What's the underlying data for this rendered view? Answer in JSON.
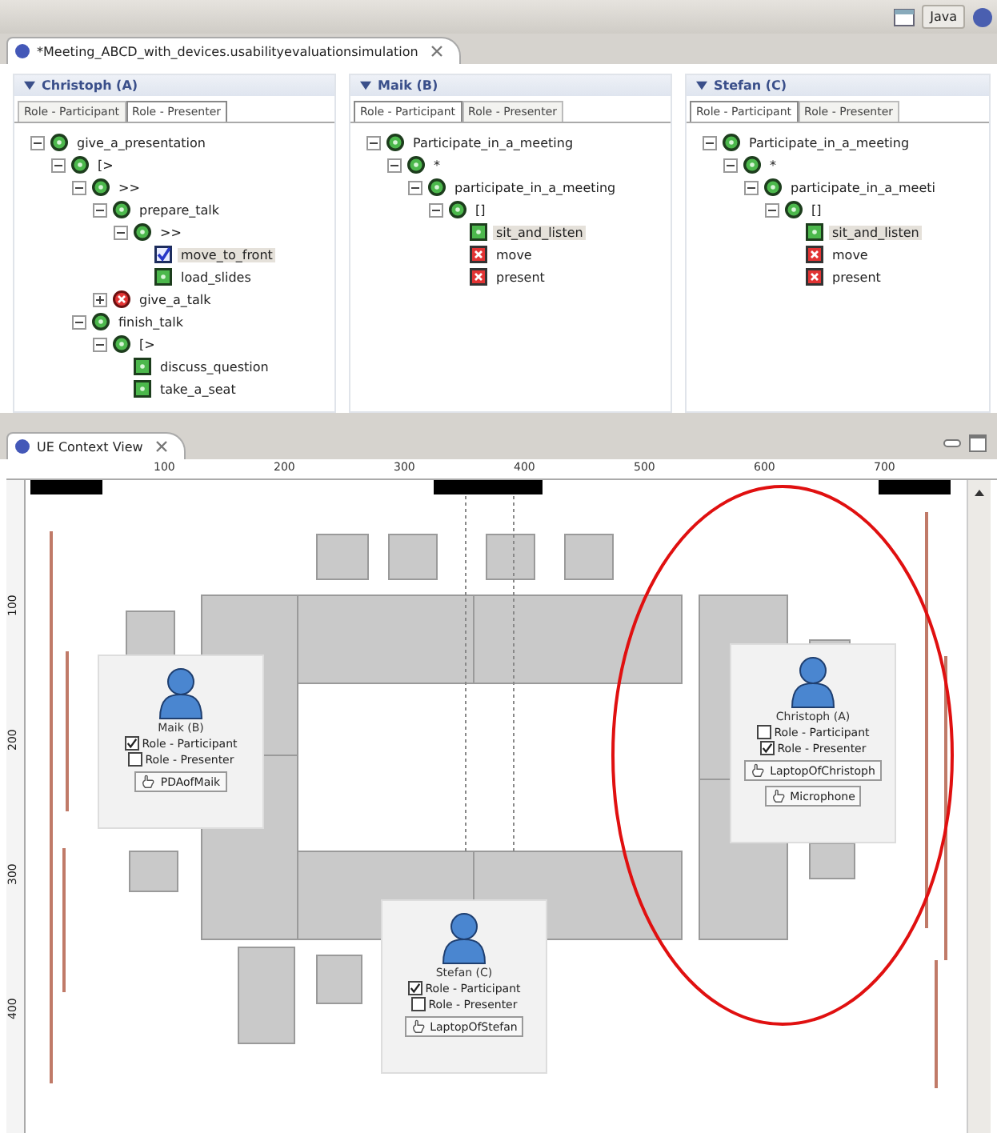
{
  "toolbar": {
    "perspective": "Java"
  },
  "editor": {
    "title": "*Meeting_ABCD_with_devices.usabilityevaluationsimulation",
    "panels": [
      {
        "title": "Christoph (A)",
        "tabs": [
          {
            "label": "Role - Participant",
            "selected": false
          },
          {
            "label": "Role - Presenter",
            "selected": true
          }
        ],
        "tree": [
          {
            "label": "give_a_presentation",
            "kind": "ok",
            "expanded": true,
            "selected": false,
            "children": [
              {
                "label": "[>",
                "kind": "ok",
                "expanded": true,
                "selected": false,
                "children": [
                  {
                    "label": ">>",
                    "kind": "ok",
                    "expanded": true,
                    "selected": false,
                    "children": [
                      {
                        "label": "prepare_talk",
                        "kind": "ok",
                        "expanded": true,
                        "selected": false,
                        "children": [
                          {
                            "label": ">>",
                            "kind": "ok",
                            "expanded": true,
                            "selected": false,
                            "children": [
                              {
                                "label": "move_to_front",
                                "kind": "done",
                                "selected": true
                              },
                              {
                                "label": "load_slides",
                                "kind": "ok-task",
                                "selected": false
                              }
                            ]
                          }
                        ]
                      },
                      {
                        "label": "give_a_talk",
                        "kind": "fail",
                        "expanded": false,
                        "selected": false
                      }
                    ]
                  },
                  {
                    "label": "finish_talk",
                    "kind": "ok",
                    "expanded": true,
                    "selected": false,
                    "children": [
                      {
                        "label": "[>",
                        "kind": "ok",
                        "expanded": true,
                        "selected": false,
                        "children": [
                          {
                            "label": "discuss_question",
                            "kind": "ok-task",
                            "selected": false
                          },
                          {
                            "label": "take_a_seat",
                            "kind": "ok-task",
                            "selected": false
                          }
                        ]
                      }
                    ]
                  }
                ]
              }
            ]
          }
        ]
      },
      {
        "title": "Maik (B)",
        "tabs": [
          {
            "label": "Role - Participant",
            "selected": true
          },
          {
            "label": "Role - Presenter",
            "selected": false
          }
        ],
        "tree": [
          {
            "label": "Participate_in_a_meeting",
            "kind": "ok",
            "expanded": true,
            "selected": false,
            "children": [
              {
                "label": "*",
                "kind": "ok",
                "expanded": true,
                "selected": false,
                "children": [
                  {
                    "label": "participate_in_a_meeting",
                    "kind": "ok",
                    "expanded": true,
                    "selected": false,
                    "children": [
                      {
                        "label": "[]",
                        "kind": "ok",
                        "expanded": true,
                        "selected": false,
                        "children": [
                          {
                            "label": "sit_and_listen",
                            "kind": "ok-task",
                            "selected": true
                          },
                          {
                            "label": "move",
                            "kind": "fail-task",
                            "selected": false
                          },
                          {
                            "label": "present",
                            "kind": "fail-task",
                            "selected": false
                          }
                        ]
                      }
                    ]
                  }
                ]
              }
            ]
          }
        ]
      },
      {
        "title": "Stefan (C)",
        "tabs": [
          {
            "label": "Role - Participant",
            "selected": true
          },
          {
            "label": "Role - Presenter",
            "selected": false
          }
        ],
        "tree": [
          {
            "label": "Participate_in_a_meeting",
            "kind": "ok",
            "expanded": true,
            "selected": false,
            "children": [
              {
                "label": "*",
                "kind": "ok",
                "expanded": true,
                "selected": false,
                "children": [
                  {
                    "label": "participate_in_a_meeti",
                    "kind": "ok",
                    "expanded": true,
                    "selected": false,
                    "children": [
                      {
                        "label": "[]",
                        "kind": "ok",
                        "expanded": true,
                        "selected": false,
                        "children": [
                          {
                            "label": "sit_and_listen",
                            "kind": "ok-task",
                            "selected": true
                          },
                          {
                            "label": "move",
                            "kind": "fail-task",
                            "selected": false
                          },
                          {
                            "label": "present",
                            "kind": "fail-task",
                            "selected": false
                          }
                        ]
                      }
                    ]
                  }
                ]
              }
            ]
          }
        ]
      }
    ]
  },
  "context_view": {
    "title": "UE Context View",
    "ruler": [
      "100",
      "200",
      "300",
      "400",
      "500",
      "600",
      "700"
    ],
    "vertical_ruler": [
      "100",
      "200",
      "300",
      "400"
    ],
    "people": [
      {
        "name": "Maik (B)",
        "roles": [
          {
            "label": "Role - Participant",
            "checked": true
          },
          {
            "label": "Role - Presenter",
            "checked": false
          }
        ],
        "devices": [
          "PDAofMaik"
        ]
      },
      {
        "name": "Stefan (C)",
        "roles": [
          {
            "label": "Role - Participant",
            "checked": true
          },
          {
            "label": "Role - Presenter",
            "checked": false
          }
        ],
        "devices": [
          "LaptopOfStefan"
        ]
      },
      {
        "name": "Christoph (A)",
        "roles": [
          {
            "label": "Role - Participant",
            "checked": false
          },
          {
            "label": "Role - Presenter",
            "checked": true
          }
        ],
        "devices": [
          "LaptopOfChristoph",
          "Microphone"
        ]
      }
    ]
  }
}
